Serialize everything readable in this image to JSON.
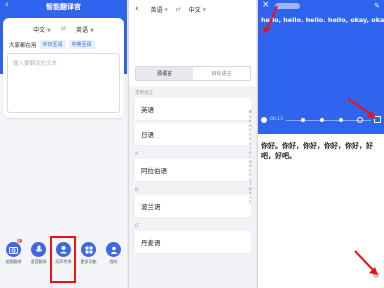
{
  "panel1": {
    "title": "智能翻译官",
    "source_lang": "中文",
    "target_lang": "英语",
    "recent_label": "大家都在用",
    "chips": [
      "中日互译",
      "中英互译"
    ],
    "input_placeholder": "输入要翻译的文本",
    "functions": [
      {
        "label": "拍照翻译",
        "icon": "camera-icon",
        "badge": "新"
      },
      {
        "label": "语音翻译",
        "icon": "microphone-icon"
      },
      {
        "label": "同声传译",
        "icon": "headset-icon"
      },
      {
        "label": "更多功能",
        "icon": "grid-icon"
      },
      {
        "label": "我的",
        "icon": "user-icon"
      }
    ]
  },
  "panel2": {
    "source_lang": "英语",
    "target_lang": "中文",
    "tabs": [
      "源语言",
      "目标语言"
    ],
    "section_label": "常用语言",
    "items": [
      {
        "section": "",
        "label": "英语"
      },
      {
        "section": "",
        "label": "日语"
      },
      {
        "section": "A",
        "label": "阿拉伯语"
      },
      {
        "section": "B",
        "label": "波兰语"
      },
      {
        "section": "D",
        "label": "丹麦语"
      }
    ],
    "index": [
      "常",
      "A",
      "B",
      "D",
      "E",
      "F",
      "G",
      "H",
      "J",
      "K",
      "L",
      "M",
      "N",
      "P",
      "R",
      "S",
      "T",
      "W",
      "X",
      "Y",
      "Z"
    ]
  },
  "panel3": {
    "english_text": "hello, hello. hello. hello, okay, okay.",
    "time": "00:13",
    "chinese_text": "你好。你好，你好，你好，你好，好吧，好吧。"
  }
}
